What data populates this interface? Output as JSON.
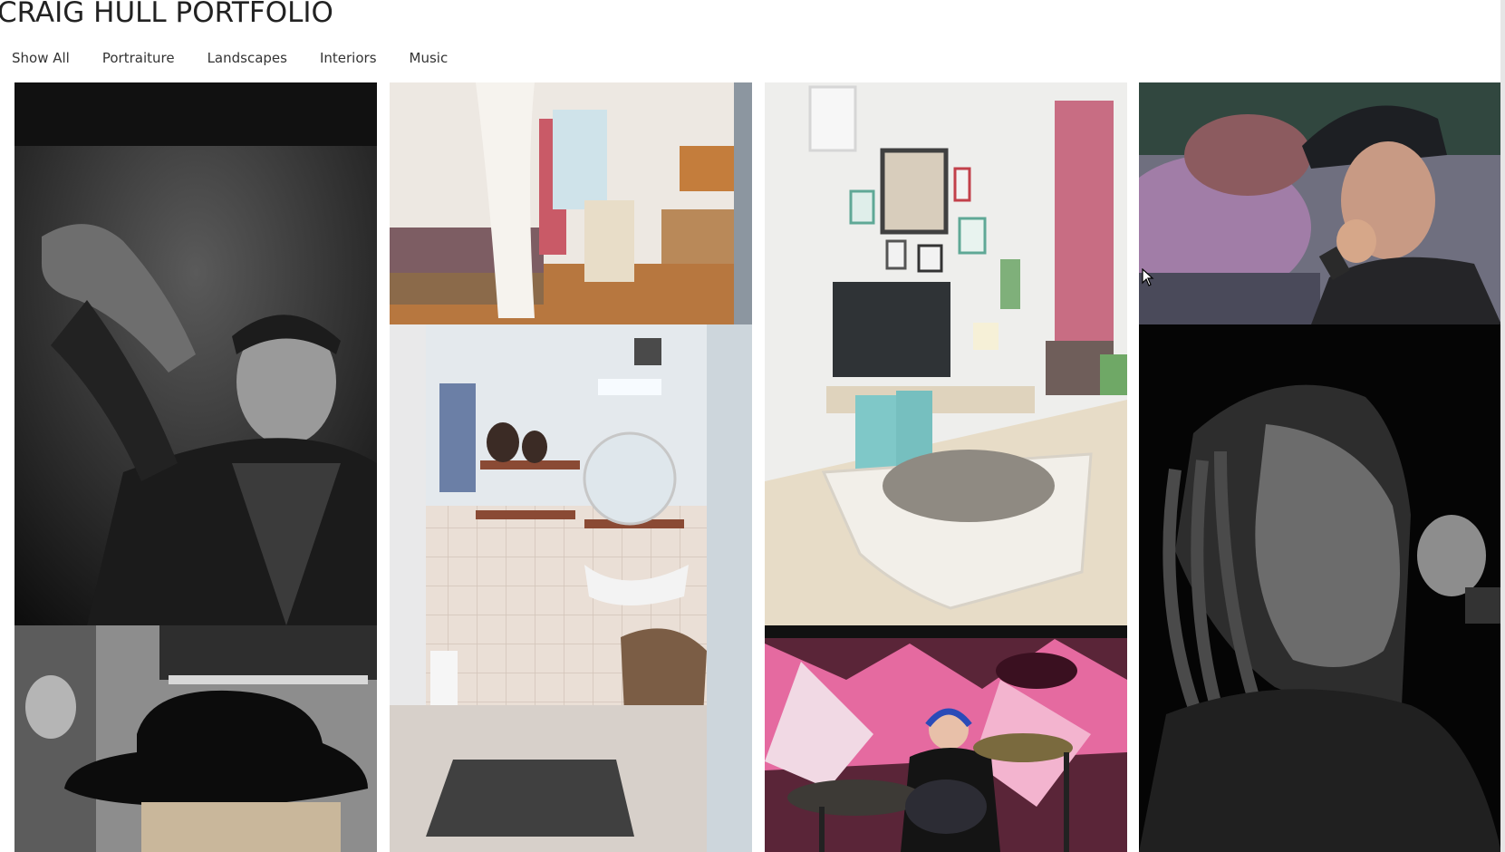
{
  "site": {
    "title": "CRAIG HULL PORTFOLIO"
  },
  "filters": [
    {
      "label": "Show All"
    },
    {
      "label": "Portraiture"
    },
    {
      "label": "Landscapes"
    },
    {
      "label": "Interiors"
    },
    {
      "label": "Music"
    }
  ],
  "photos": [
    {
      "id": "man-leather-jacket",
      "icon": "portrait-photo",
      "tone": "monochrome"
    },
    {
      "id": "person-black-hat",
      "icon": "portrait-photo",
      "tone": "monochrome"
    },
    {
      "id": "bedroom-kitchen",
      "icon": "interior-photo",
      "tone": "color"
    },
    {
      "id": "bathroom",
      "icon": "interior-photo",
      "tone": "color"
    },
    {
      "id": "living-room-tv",
      "icon": "interior-photo",
      "tone": "color"
    },
    {
      "id": "drummer-stage",
      "icon": "music-photo",
      "tone": "color"
    },
    {
      "id": "singer-cap-microphone",
      "icon": "music-photo",
      "tone": "color"
    },
    {
      "id": "singer-dreadlocks",
      "icon": "music-photo",
      "tone": "monochrome"
    }
  ],
  "colors": {
    "title": "#222222",
    "nav_text": "#333333",
    "background": "#ffffff"
  }
}
